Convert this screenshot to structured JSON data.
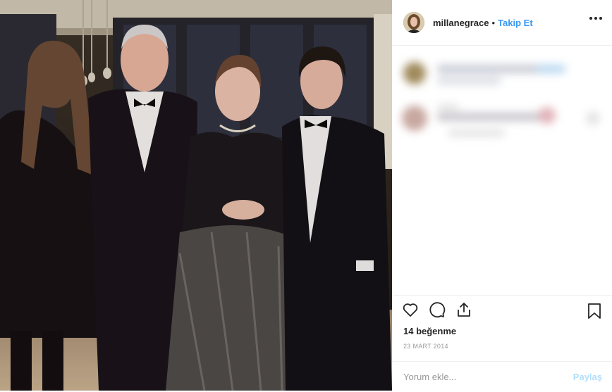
{
  "post": {
    "username": "millanegrace",
    "separator": "•",
    "follow_label": "Takip Et",
    "likes": "14 beğenme",
    "date": "23 MART 2014",
    "comment_placeholder": "Yorum ekle...",
    "share_label": "Paylaş"
  },
  "icons": {
    "like": "heart-icon",
    "comment": "comment-icon",
    "share": "share-icon",
    "save": "bookmark-icon",
    "more": "more-options-icon"
  },
  "colors": {
    "accent": "#3897f0",
    "share_disabled": "#b2dffc",
    "text": "#262626",
    "muted": "#999999"
  }
}
